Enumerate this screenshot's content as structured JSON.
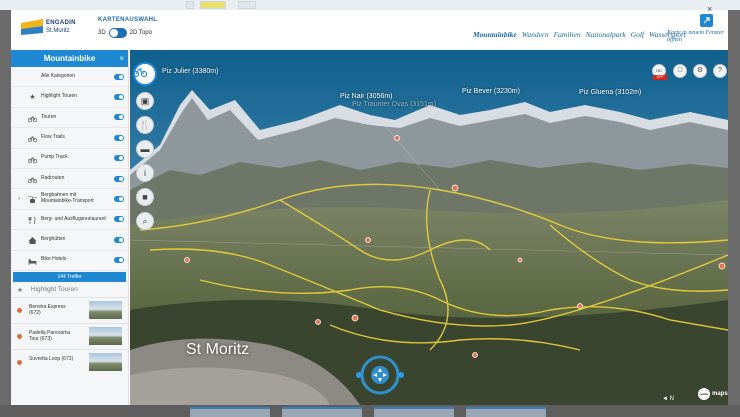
{
  "header": {
    "logo_line1": "ENGADIN",
    "logo_line2": "St.Moritz",
    "kartenauswahl": "KARTENAUSWAHL",
    "toggle_left": "3D",
    "toggle_right": "2D Topo",
    "nav": [
      {
        "label": "Mountainbike",
        "active": true
      },
      {
        "label": "Wandern"
      },
      {
        "label": "Familien"
      },
      {
        "label": "Nationalpark"
      },
      {
        "label": "Golf"
      },
      {
        "label": "Wassersport"
      }
    ],
    "new_window": "Karte in neuem Fenster öffnen"
  },
  "sidebar": {
    "title": "Mountainbike",
    "close_label": "×",
    "items": [
      {
        "label": "Alle Kategorien",
        "icon": "none"
      },
      {
        "label": "Highlight Touren",
        "icon": "star-icon"
      },
      {
        "label": "Touren",
        "icon": "bike-icon"
      },
      {
        "label": "Flow Trails",
        "icon": "bike-icon"
      },
      {
        "label": "Pump Track",
        "icon": "bike-icon"
      },
      {
        "label": "Radrouten",
        "icon": "bike-icon"
      },
      {
        "label": "Bergbahnen mit Mountainbike-Transport",
        "icon": "cablecar-icon",
        "expandable": true
      },
      {
        "label": "Berg- und Ausflugsrestaurant",
        "icon": "restaurant-icon"
      },
      {
        "label": "Berghütten",
        "icon": "hut-icon"
      },
      {
        "label": "Bike Hotels",
        "icon": "bed-icon"
      }
    ],
    "treffer": "144 Treffer",
    "highlight_section": "Highlight Touren",
    "tours": [
      {
        "name": "Bernina Express (672)"
      },
      {
        "name": "Padella Panorama Tour (673)"
      },
      {
        "name": "Suvretta Loop (671)"
      }
    ]
  },
  "map": {
    "peaks": [
      {
        "label": "Piz Julier (3380m)"
      },
      {
        "label": "Piz Nair (3056m)"
      },
      {
        "label": "Piz Traunter Ovas (3151m)",
        "faint": true
      },
      {
        "label": "Piz Bever (3230m)"
      },
      {
        "label": "Piz Gluena (3102m)"
      }
    ],
    "town": "St Moritz",
    "hd_label": "HD",
    "off_label": "OFF",
    "brand_reality": "reality",
    "brand_maps": "maps",
    "compass_label": "◄ N"
  },
  "colors": {
    "accent": "#1e88d2",
    "trail": "#f0d23a",
    "brand_dark": "#1a3d6d"
  }
}
